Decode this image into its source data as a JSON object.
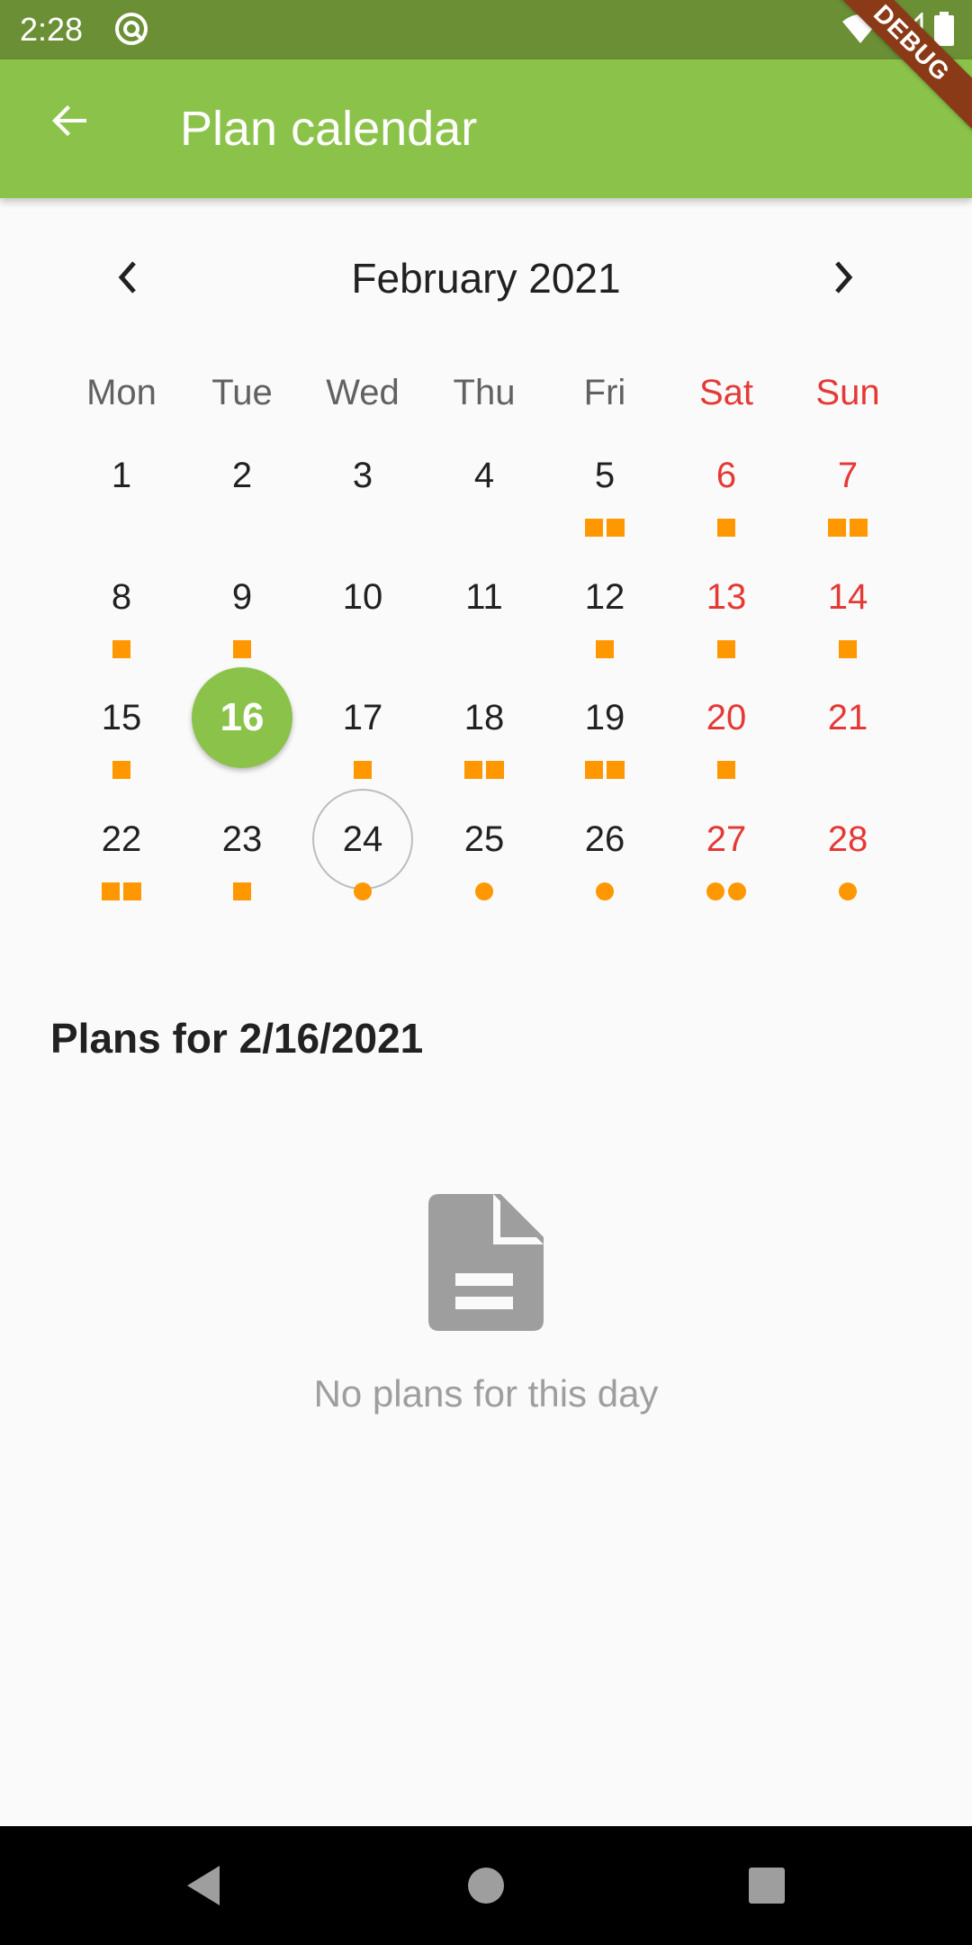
{
  "status_bar": {
    "time": "2:28",
    "icons": [
      "app-notification-icon",
      "wifi-icon",
      "signal-icon",
      "battery-icon"
    ]
  },
  "app_bar": {
    "title": "Plan calendar",
    "back_icon": "arrow-back-icon",
    "bg_color": "#8bc34a"
  },
  "debug_banner": "DEBUG",
  "calendar": {
    "month_label": "February 2021",
    "prev_icon": "chevron-left-icon",
    "next_icon": "chevron-right-icon",
    "weekdays": [
      "Mon",
      "Tue",
      "Wed",
      "Thu",
      "Fri",
      "Sat",
      "Sun"
    ],
    "selected_day": "16",
    "today": "24",
    "marker_color": "#ff9800",
    "weekend_color": "#e53935",
    "days": [
      {
        "label": "1",
        "markers": []
      },
      {
        "label": "2",
        "markers": []
      },
      {
        "label": "3",
        "markers": []
      },
      {
        "label": "4",
        "markers": []
      },
      {
        "label": "5",
        "markers": [
          "square",
          "square"
        ]
      },
      {
        "label": "6",
        "markers": [
          "square"
        ]
      },
      {
        "label": "7",
        "markers": [
          "square",
          "square"
        ]
      },
      {
        "label": "8",
        "markers": [
          "square"
        ]
      },
      {
        "label": "9",
        "markers": [
          "square"
        ]
      },
      {
        "label": "10",
        "markers": []
      },
      {
        "label": "11",
        "markers": []
      },
      {
        "label": "12",
        "markers": [
          "square"
        ]
      },
      {
        "label": "13",
        "markers": [
          "square"
        ]
      },
      {
        "label": "14",
        "markers": [
          "square"
        ]
      },
      {
        "label": "15",
        "markers": [
          "square"
        ]
      },
      {
        "label": "16",
        "markers": []
      },
      {
        "label": "17",
        "markers": [
          "square"
        ]
      },
      {
        "label": "18",
        "markers": [
          "square",
          "square"
        ]
      },
      {
        "label": "19",
        "markers": [
          "square",
          "square"
        ]
      },
      {
        "label": "20",
        "markers": [
          "square"
        ]
      },
      {
        "label": "21",
        "markers": []
      },
      {
        "label": "22",
        "markers": [
          "square",
          "square"
        ]
      },
      {
        "label": "23",
        "markers": [
          "square"
        ]
      },
      {
        "label": "24",
        "markers": [
          "dot"
        ]
      },
      {
        "label": "25",
        "markers": [
          "dot"
        ]
      },
      {
        "label": "26",
        "markers": [
          "dot"
        ]
      },
      {
        "label": "27",
        "markers": [
          "dot",
          "dot"
        ]
      },
      {
        "label": "28",
        "markers": [
          "dot"
        ]
      }
    ]
  },
  "plans": {
    "heading": "Plans for 2/16/2021",
    "empty_icon": "document-icon",
    "empty_text": "No plans for this day"
  },
  "nav_bar": {
    "icons": [
      "back-triangle-icon",
      "home-circle-icon",
      "recents-square-icon"
    ]
  }
}
